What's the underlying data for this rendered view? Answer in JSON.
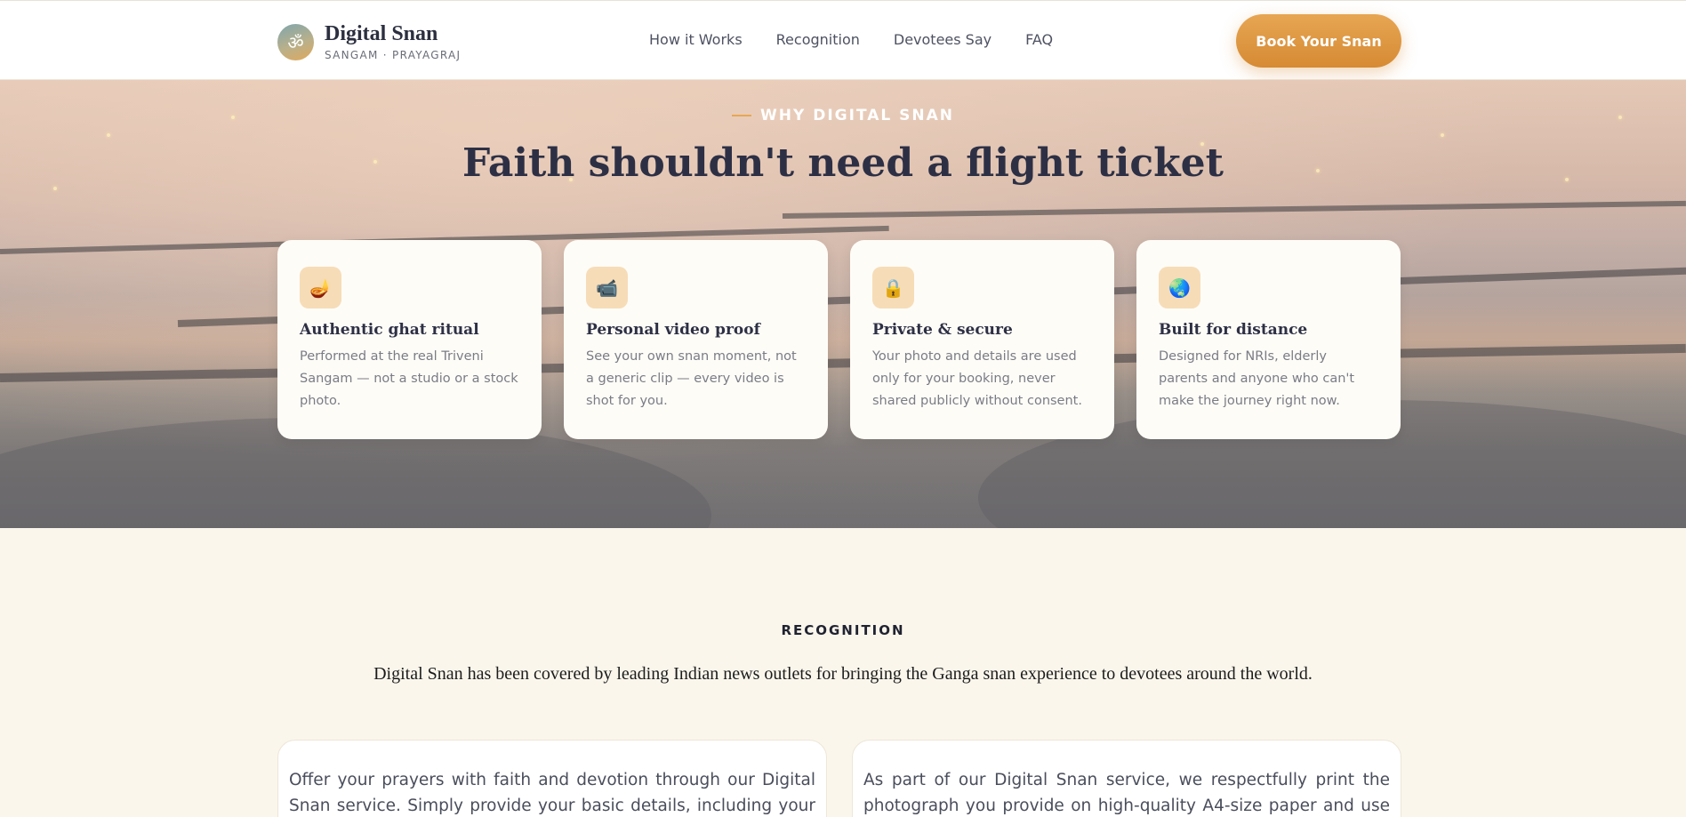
{
  "header": {
    "logo_glyph": "ॐ",
    "brand_name": "Digital Snan",
    "brand_sub": "SANGAM · PRAYAGRAJ",
    "nav": [
      "How it Works",
      "Recognition",
      "Devotees Say",
      "FAQ"
    ],
    "cta": "Book Your Snan"
  },
  "hero": {
    "eyebrow": "WHY DIGITAL SNAN",
    "title": "Faith shouldn't need a flight ticket",
    "cards": [
      {
        "icon": "diya-icon",
        "glyph": "🪔",
        "title": "Authentic ghat ritual",
        "text": "Performed at the real Triveni Sangam — not a studio or a stock photo."
      },
      {
        "icon": "camera-icon",
        "glyph": "📹",
        "title": "Personal video proof",
        "text": "See your own snan moment, not a generic clip — every video is shot for you."
      },
      {
        "icon": "lock-icon",
        "glyph": "🔒",
        "title": "Private & secure",
        "text": "Your photo and details are used only for your booking, never shared publicly without consent."
      },
      {
        "icon": "globe-icon",
        "glyph": "🌏",
        "title": "Built for distance",
        "text": "Designed for NRIs, elderly parents and anyone who can't make the journey right now."
      }
    ]
  },
  "recognition": {
    "label": "RECOGNITION",
    "description": "Digital Snan has been covered by leading Indian news outlets for bringing the Ganga snan experience to devotees around the world.",
    "cards": [
      "Offer your prayers with faith and devotion through our Digital Snan service. Simply provide your basic details, including your full name,",
      "As part of our Digital Snan service, we respectfully print the photograph you provide on high-quality A4-size paper and use it during the sacred"
    ]
  },
  "colors": {
    "accent": "#e7a653",
    "heading": "#2d3045",
    "page_bg": "#faf6ec"
  }
}
